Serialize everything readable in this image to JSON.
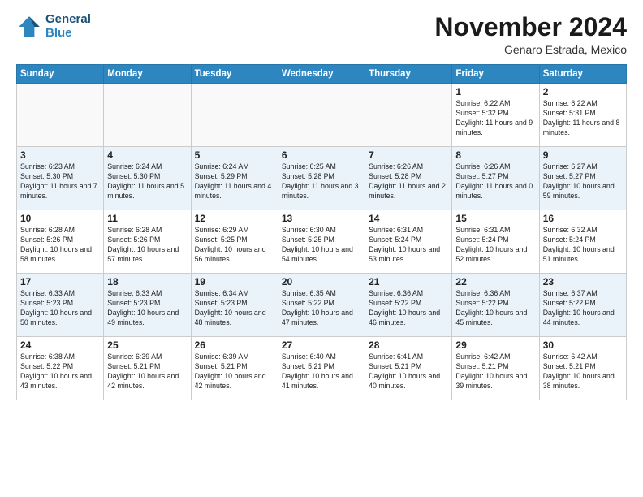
{
  "header": {
    "logo_line1": "General",
    "logo_line2": "Blue",
    "month_title": "November 2024",
    "location": "Genaro Estrada, Mexico"
  },
  "weekdays": [
    "Sunday",
    "Monday",
    "Tuesday",
    "Wednesday",
    "Thursday",
    "Friday",
    "Saturday"
  ],
  "weeks": [
    [
      {
        "day": "",
        "text": ""
      },
      {
        "day": "",
        "text": ""
      },
      {
        "day": "",
        "text": ""
      },
      {
        "day": "",
        "text": ""
      },
      {
        "day": "",
        "text": ""
      },
      {
        "day": "1",
        "text": "Sunrise: 6:22 AM\nSunset: 5:32 PM\nDaylight: 11 hours and 9 minutes."
      },
      {
        "day": "2",
        "text": "Sunrise: 6:22 AM\nSunset: 5:31 PM\nDaylight: 11 hours and 8 minutes."
      }
    ],
    [
      {
        "day": "3",
        "text": "Sunrise: 6:23 AM\nSunset: 5:30 PM\nDaylight: 11 hours and 7 minutes."
      },
      {
        "day": "4",
        "text": "Sunrise: 6:24 AM\nSunset: 5:30 PM\nDaylight: 11 hours and 5 minutes."
      },
      {
        "day": "5",
        "text": "Sunrise: 6:24 AM\nSunset: 5:29 PM\nDaylight: 11 hours and 4 minutes."
      },
      {
        "day": "6",
        "text": "Sunrise: 6:25 AM\nSunset: 5:28 PM\nDaylight: 11 hours and 3 minutes."
      },
      {
        "day": "7",
        "text": "Sunrise: 6:26 AM\nSunset: 5:28 PM\nDaylight: 11 hours and 2 minutes."
      },
      {
        "day": "8",
        "text": "Sunrise: 6:26 AM\nSunset: 5:27 PM\nDaylight: 11 hours and 0 minutes."
      },
      {
        "day": "9",
        "text": "Sunrise: 6:27 AM\nSunset: 5:27 PM\nDaylight: 10 hours and 59 minutes."
      }
    ],
    [
      {
        "day": "10",
        "text": "Sunrise: 6:28 AM\nSunset: 5:26 PM\nDaylight: 10 hours and 58 minutes."
      },
      {
        "day": "11",
        "text": "Sunrise: 6:28 AM\nSunset: 5:26 PM\nDaylight: 10 hours and 57 minutes."
      },
      {
        "day": "12",
        "text": "Sunrise: 6:29 AM\nSunset: 5:25 PM\nDaylight: 10 hours and 56 minutes."
      },
      {
        "day": "13",
        "text": "Sunrise: 6:30 AM\nSunset: 5:25 PM\nDaylight: 10 hours and 54 minutes."
      },
      {
        "day": "14",
        "text": "Sunrise: 6:31 AM\nSunset: 5:24 PM\nDaylight: 10 hours and 53 minutes."
      },
      {
        "day": "15",
        "text": "Sunrise: 6:31 AM\nSunset: 5:24 PM\nDaylight: 10 hours and 52 minutes."
      },
      {
        "day": "16",
        "text": "Sunrise: 6:32 AM\nSunset: 5:24 PM\nDaylight: 10 hours and 51 minutes."
      }
    ],
    [
      {
        "day": "17",
        "text": "Sunrise: 6:33 AM\nSunset: 5:23 PM\nDaylight: 10 hours and 50 minutes."
      },
      {
        "day": "18",
        "text": "Sunrise: 6:33 AM\nSunset: 5:23 PM\nDaylight: 10 hours and 49 minutes."
      },
      {
        "day": "19",
        "text": "Sunrise: 6:34 AM\nSunset: 5:23 PM\nDaylight: 10 hours and 48 minutes."
      },
      {
        "day": "20",
        "text": "Sunrise: 6:35 AM\nSunset: 5:22 PM\nDaylight: 10 hours and 47 minutes."
      },
      {
        "day": "21",
        "text": "Sunrise: 6:36 AM\nSunset: 5:22 PM\nDaylight: 10 hours and 46 minutes."
      },
      {
        "day": "22",
        "text": "Sunrise: 6:36 AM\nSunset: 5:22 PM\nDaylight: 10 hours and 45 minutes."
      },
      {
        "day": "23",
        "text": "Sunrise: 6:37 AM\nSunset: 5:22 PM\nDaylight: 10 hours and 44 minutes."
      }
    ],
    [
      {
        "day": "24",
        "text": "Sunrise: 6:38 AM\nSunset: 5:22 PM\nDaylight: 10 hours and 43 minutes."
      },
      {
        "day": "25",
        "text": "Sunrise: 6:39 AM\nSunset: 5:21 PM\nDaylight: 10 hours and 42 minutes."
      },
      {
        "day": "26",
        "text": "Sunrise: 6:39 AM\nSunset: 5:21 PM\nDaylight: 10 hours and 42 minutes."
      },
      {
        "day": "27",
        "text": "Sunrise: 6:40 AM\nSunset: 5:21 PM\nDaylight: 10 hours and 41 minutes."
      },
      {
        "day": "28",
        "text": "Sunrise: 6:41 AM\nSunset: 5:21 PM\nDaylight: 10 hours and 40 minutes."
      },
      {
        "day": "29",
        "text": "Sunrise: 6:42 AM\nSunset: 5:21 PM\nDaylight: 10 hours and 39 minutes."
      },
      {
        "day": "30",
        "text": "Sunrise: 6:42 AM\nSunset: 5:21 PM\nDaylight: 10 hours and 38 minutes."
      }
    ]
  ]
}
